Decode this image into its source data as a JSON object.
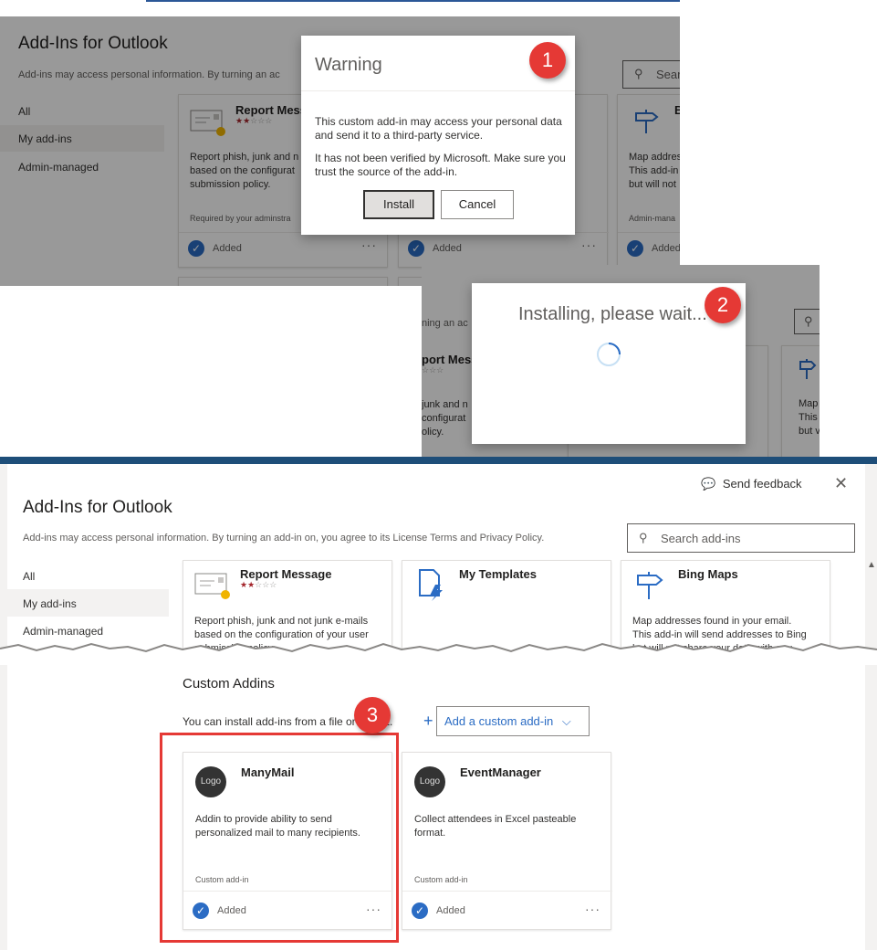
{
  "panel1": {
    "title": "Add-Ins for Outlook",
    "subtitle": "Add-ins may access personal information. By turning an ac",
    "search_placeholder": "Sear",
    "nav": [
      "All",
      "My add-ins",
      "Admin-managed"
    ],
    "card1": {
      "name": "Report Messa",
      "desc_lines": [
        "Report phish, junk and n",
        "based on the configurat",
        "submission policy."
      ],
      "required": "Required by your adminstra",
      "added": "Added"
    },
    "card2": {
      "added": "Added"
    },
    "card3": {
      "name": "B",
      "desc_lines": [
        "Map addres",
        "This add-in",
        "but will not"
      ],
      "admin": "Admin-mana",
      "added": "Added"
    },
    "dialog": {
      "title": "Warning",
      "text1": "This custom add-in may access your personal data and send it to a third-party service.",
      "text2": "It has not been verified by Microsoft. Make sure you trust the source of the add-in.",
      "install": "Install",
      "cancel": "Cancel"
    },
    "badge": "1"
  },
  "panel2": {
    "subtitle_frag": "ning an ac",
    "card_name_frag": "port Mess",
    "stars_frag": "☆☆☆",
    "desc_lines": [
      "junk and n",
      "configurat",
      "olicy."
    ],
    "right_frag": [
      "Map",
      "This",
      "but v"
    ],
    "dialog_text": "Installing, please wait...",
    "badge": "2"
  },
  "panel3": {
    "title": "Add-Ins for Outlook",
    "subtitle": "Add-ins may access personal information. By turning an add-in on, you agree to its License Terms and Privacy Policy.",
    "send_feedback": "Send feedback",
    "search_placeholder": "Search add-ins",
    "nav": [
      "All",
      "My add-ins",
      "Admin-managed"
    ],
    "top_cards": [
      {
        "name": "Report Message",
        "desc_lines": [
          "Report phish, junk and not junk e-mails",
          "based on the configuration of your user",
          "submission policy..."
        ]
      },
      {
        "name": "My Templates",
        "desc_lines": []
      },
      {
        "name": "Bing Maps",
        "desc_lines": [
          "Map addresses found in your email.",
          "This add-in will send addresses to Bing",
          "but will not share your data with any..."
        ]
      }
    ],
    "custom_heading": "Custom Addins",
    "custom_text": "You can install add-ins from a file or a URL.",
    "add_custom": "Add a custom add-in",
    "custom_cards": [
      {
        "logo": "Logo",
        "name": "ManyMail",
        "desc_lines": [
          "Addin to provide ability to send",
          "personalized mail to many recipients."
        ],
        "type": "Custom add-in",
        "added": "Added"
      },
      {
        "logo": "Logo",
        "name": "EventManager",
        "desc_lines": [
          "Collect attendees in Excel pasteable",
          "format."
        ],
        "type": "Custom add-in",
        "added": "Added"
      }
    ],
    "badge": "3"
  },
  "colors": {
    "accent": "#2b6cc4",
    "badge": "#e53935",
    "highlight": "#e53935",
    "topbar": "#2b5797"
  }
}
